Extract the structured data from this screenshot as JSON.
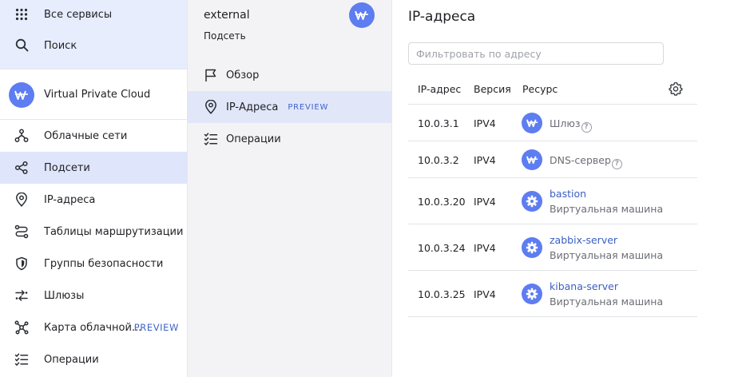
{
  "sidebar": {
    "top_items": [
      {
        "label": "Все сервисы",
        "icon": "grid-icon"
      },
      {
        "label": "Поиск",
        "icon": "search-icon"
      }
    ],
    "service": {
      "label": "Virtual Private Cloud",
      "icon": "vpc-icon"
    },
    "items": [
      {
        "label": "Облачные сети",
        "icon": "cloud-networks-icon"
      },
      {
        "label": "Подсети",
        "icon": "subnets-icon"
      },
      {
        "label": "IP-адреса",
        "icon": "map-pin-icon"
      },
      {
        "label": "Таблицы маршрутизации",
        "icon": "route-icon"
      },
      {
        "label": "Группы безопасности",
        "icon": "shield-icon"
      },
      {
        "label": "Шлюзы",
        "icon": "gateway-icon"
      },
      {
        "label": "Карта облачной...",
        "icon": "network-map-icon",
        "badge": "PREVIEW"
      },
      {
        "label": "Операции",
        "icon": "operations-list-icon"
      }
    ]
  },
  "subnet": {
    "name": "external",
    "type": "Подсеть",
    "nav": [
      {
        "label": "Обзор",
        "icon": "flag-icon"
      },
      {
        "label": "IP-Адреса",
        "icon": "map-pin-icon",
        "badge": "PREVIEW"
      },
      {
        "label": "Операции",
        "icon": "operations-list-icon"
      }
    ]
  },
  "main": {
    "title": "IP-адреса",
    "filter_placeholder": "Фильтровать по адресу",
    "columns": [
      "IP-адрес",
      "Версия",
      "Ресурс"
    ],
    "rows": [
      {
        "ip": "10.0.3.1",
        "version": "IPV4",
        "resource": "Шлюз",
        "resource_type": "",
        "icon": "gateway-resource-icon"
      },
      {
        "ip": "10.0.3.2",
        "version": "IPV4",
        "resource": "DNS-сервер",
        "resource_type": "",
        "icon": "dns-resource-icon"
      },
      {
        "ip": "10.0.3.20",
        "version": "IPV4",
        "resource": "bastion",
        "resource_type": "Виртуальная машина",
        "icon": "vm-gear-icon"
      },
      {
        "ip": "10.0.3.24",
        "version": "IPV4",
        "resource": "zabbix-server",
        "resource_type": "Виртуальная машина",
        "icon": "vm-gear-icon"
      },
      {
        "ip": "10.0.3.25",
        "version": "IPV4",
        "resource": "kibana-server",
        "resource_type": "Виртуальная машина",
        "icon": "vm-gear-icon"
      }
    ]
  },
  "colors": {
    "accent": "#5d7df1",
    "link": "#3a5fc3",
    "sidebar_active": "#dfe5fb",
    "panel_bg": "#f3f3f5"
  }
}
